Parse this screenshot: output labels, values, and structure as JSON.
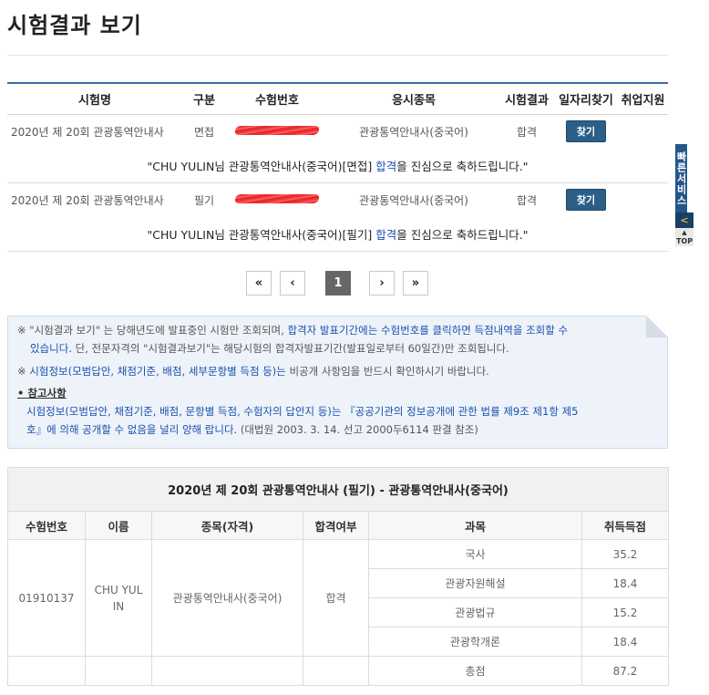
{
  "page_title": "시험결과 보기",
  "results": {
    "headers": [
      "시험명",
      "구분",
      "수험번호",
      "응시종목",
      "시험결과",
      "일자리찾기",
      "취업지원"
    ],
    "rows": [
      {
        "exam": "2020년 제 20회 관광통역안내사",
        "type": "면접",
        "category": "관광통역안내사(중국어)",
        "result": "합격",
        "find_label": "찾기",
        "msg_before": "\"CHU YULIN님 관광통역안내사(중국어)[면접] ",
        "msg_link": "합격",
        "msg_after": "을 진심으로 축하드립니다.\""
      },
      {
        "exam": "2020년 제 20회 관광통역안내사",
        "type": "필기",
        "category": "관광통역안내사(중국어)",
        "result": "합격",
        "find_label": "찾기",
        "msg_before": "\"CHU YULIN님 관광통역안내사(중국어)[필기] ",
        "msg_link": "합격",
        "msg_after": "을 진심으로 축하드립니다.\""
      }
    ]
  },
  "pagination": {
    "first": "«",
    "prev": "‹",
    "current": "1",
    "next": "›",
    "last": "»"
  },
  "notice": {
    "line1_a": "※ \"시험결과 보기\" 는 당해년도에 발표중인 시험만 조회되며, ",
    "line1_b": "합격자 발표기간에는 수험번호를 클릭하면 득점내역을 조회할 수",
    "line2_b": "있습니다.",
    "line2_c": " 단, 전문자격의 \"시험결과보기\"는 해당시험의 합격자발표기간(발표일로부터 60일간)만 조회됩니다.",
    "line3_a": "※ ",
    "line3_b": "시험정보(모범답안, 채점기준, 배점, 세부문항별 득점 등)는",
    "line3_c": " 비공개 사항임을 반드시 확인하시기 바랍니다.",
    "ref_title": "참고사항",
    "ref_line1": "시험정보(모범답안, 채점기준, 배점, 문항별 득점, 수험자의 답안지 등)는 『공공기관의 정보공개에 관한 법률 제9조 제1항 제5",
    "ref_line2_a": "호』에 의해 공개할 수 없음을 널리 양해 랍니다.",
    "ref_line2_b": " (대법원 2003. 3. 14. 선고 2000두6114 판결 참조)"
  },
  "score": {
    "caption": "2020년 제 20회 관광통역안내사 (필기) - 관광통역안내사(중국어)",
    "headers": [
      "수험번호",
      "이름",
      "종목(자격)",
      "합격여부",
      "과목",
      "취득득점"
    ],
    "exam_number": "01910137",
    "name_line1": "CHU YUL",
    "name_line2": "IN",
    "qualification": "관광통역안내사(중국어)",
    "pass": "합격",
    "subjects": [
      {
        "name": "국사",
        "score": "35.2"
      },
      {
        "name": "관광자원해설",
        "score": "18.4"
      },
      {
        "name": "관광법규",
        "score": "15.2"
      },
      {
        "name": "관광학개론",
        "score": "18.4"
      }
    ],
    "total_label": "총점",
    "total": "87.2"
  },
  "quick_menu": {
    "label": "빠른서비스",
    "arrow": "<",
    "top": "TOP"
  }
}
